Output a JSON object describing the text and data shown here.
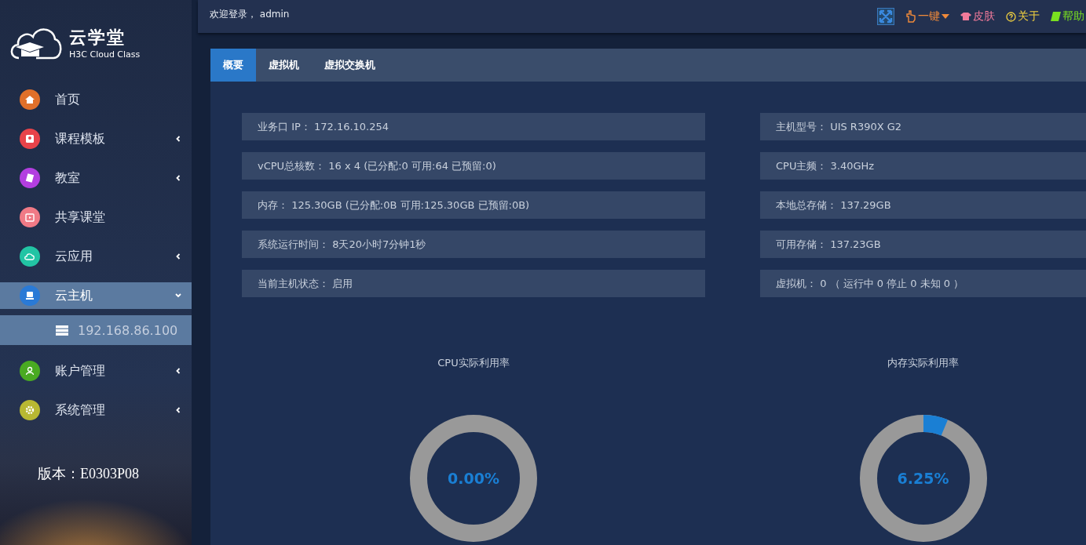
{
  "logo": {
    "title": "云学堂",
    "subtitle": "H3C Cloud Class"
  },
  "sidebar": {
    "items": [
      {
        "label": "首页",
        "color": "#e0702a",
        "kind": "link",
        "selected": false
      },
      {
        "label": "课程模板",
        "color": "#e8434a",
        "kind": "submenu",
        "expanded": false,
        "selected": false
      },
      {
        "label": "教室",
        "color": "#b33ee0",
        "kind": "submenu",
        "expanded": false,
        "selected": false
      },
      {
        "label": "共享课堂",
        "color": "#f07a86",
        "kind": "link",
        "selected": false
      },
      {
        "label": "云应用",
        "color": "#22c4a4",
        "kind": "submenu",
        "expanded": false,
        "selected": false
      },
      {
        "label": "云主机",
        "color": "#2a7ad6",
        "kind": "submenu",
        "expanded": true,
        "selected": true,
        "children": [
          {
            "label": "192.168.86.100",
            "selected": true
          }
        ]
      },
      {
        "label": "账户管理",
        "color": "#4aaa22",
        "kind": "submenu",
        "expanded": false,
        "selected": false
      },
      {
        "label": "系统管理",
        "color": "#b8b832",
        "kind": "submenu",
        "expanded": false,
        "selected": false
      }
    ]
  },
  "version": "版本：E0303P08",
  "header": {
    "welcome": "欢迎登录， admin",
    "actions": [
      {
        "label": "一键",
        "kind": "dropdown",
        "color": "#f08a3a"
      },
      {
        "label": "皮肤",
        "kind": "skin",
        "color": "#f07a9a"
      },
      {
        "label": "关于",
        "kind": "about",
        "color": "#f0d040"
      },
      {
        "label": "帮助",
        "kind": "help",
        "color": "#7ae020"
      }
    ]
  },
  "tabs": [
    {
      "label": "概要",
      "selected": true
    },
    {
      "label": "虚拟机",
      "selected": false
    },
    {
      "label": "虚拟交换机",
      "selected": false
    }
  ],
  "info_left": [
    "业务口 IP： 172.16.10.254",
    "vCPU总核数： 16 x 4 (已分配:0 可用:64 已预留:0)",
    "内存： 125.30GB (已分配:0B 可用:125.30GB 已预留:0B)",
    "系统运行时间： 8天20小时7分钟1秒",
    "当前主机状态： 启用"
  ],
  "info_right": [
    "主机型号： UIS R390X G2",
    "CPU主频： 3.40GHz",
    "本地总存储： 137.29GB",
    "可用存储： 137.23GB",
    "虚拟机： 0 （ 运行中 0 停止 0 未知 0 ）"
  ],
  "gauges": [
    {
      "title": "CPU实际利用率",
      "level": 0,
      "reading": "0.00%"
    },
    {
      "title": "内存实际利用率",
      "level": 0.0625,
      "reading": "6.25%"
    }
  ]
}
